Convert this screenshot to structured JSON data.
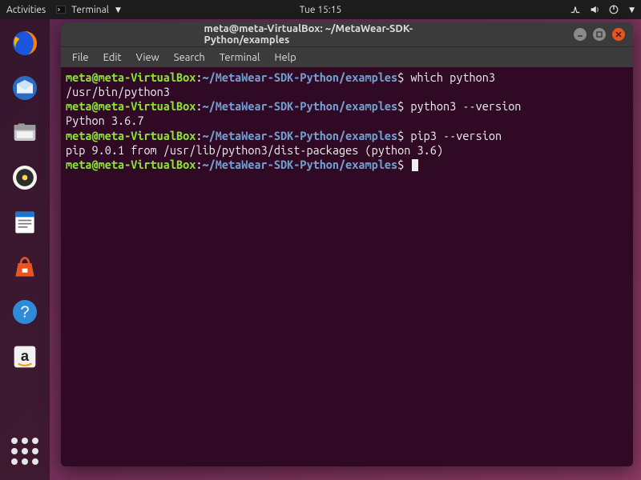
{
  "topbar": {
    "activities": "Activities",
    "app_name": "Terminal",
    "clock": "Tue 15:15"
  },
  "dock": {
    "items": [
      {
        "name": "firefox",
        "label": "Firefox"
      },
      {
        "name": "thunderbird",
        "label": "Thunderbird"
      },
      {
        "name": "files",
        "label": "Files"
      },
      {
        "name": "rhythmbox",
        "label": "Rhythmbox"
      },
      {
        "name": "writer",
        "label": "LibreOffice Writer"
      },
      {
        "name": "software",
        "label": "Ubuntu Software"
      },
      {
        "name": "help",
        "label": "Help"
      },
      {
        "name": "amazon",
        "label": "Amazon"
      }
    ],
    "apps_label": "Show Applications"
  },
  "window": {
    "title": "meta@meta-VirtualBox: ~/MetaWear-SDK-Python/examples",
    "menubar": [
      "File",
      "Edit",
      "View",
      "Search",
      "Terminal",
      "Help"
    ]
  },
  "prompt": {
    "user": "meta@meta-VirtualBox",
    "path": "~/MetaWear-SDK-Python/examples",
    "sep": ":",
    "dollar": "$"
  },
  "lines": [
    {
      "type": "prompt",
      "cmd": "which python3"
    },
    {
      "type": "output",
      "text": "/usr/bin/python3"
    },
    {
      "type": "prompt",
      "cmd": "python3 --version"
    },
    {
      "type": "output",
      "text": "Python 3.6.7"
    },
    {
      "type": "prompt",
      "cmd": "pip3 --version"
    },
    {
      "type": "output",
      "text": "pip 9.0.1 from /usr/lib/python3/dist-packages (python 3.6)"
    },
    {
      "type": "prompt",
      "cmd": "",
      "cursor": true
    }
  ]
}
